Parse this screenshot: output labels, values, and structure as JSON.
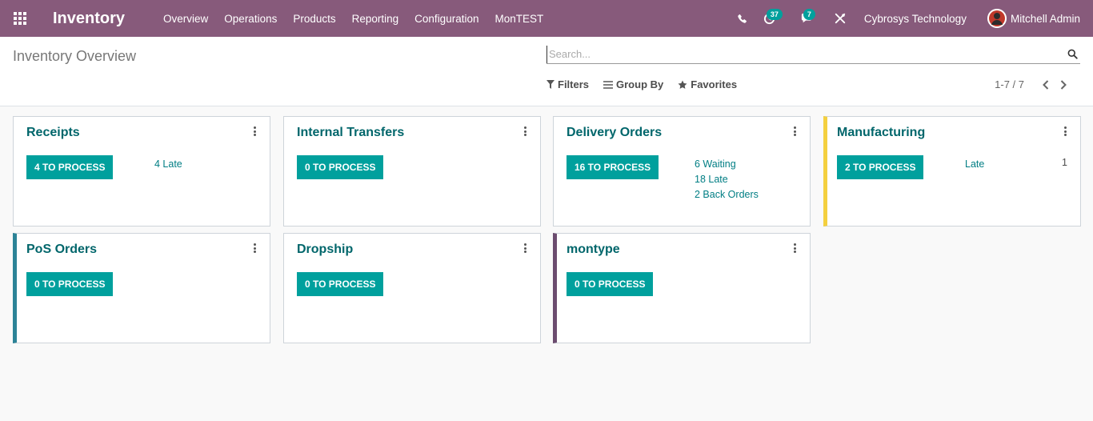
{
  "navbar": {
    "brand": "Inventory",
    "menu": [
      "Overview",
      "Operations",
      "Products",
      "Reporting",
      "Configuration",
      "MonTEST"
    ],
    "activity_badge": "37",
    "messages_badge": "7",
    "company": "Cybrosys Technology",
    "user": "Mitchell Admin",
    "bg_color": "#875a7b"
  },
  "control": {
    "title": "Inventory Overview",
    "search_placeholder": "Search...",
    "filters": "Filters",
    "group_by": "Group By",
    "favorites": "Favorites",
    "pager": "1-7 / 7"
  },
  "cards": [
    {
      "title": "Receipts",
      "button": "4 TO PROCESS",
      "stats": [
        "4 Late"
      ],
      "count": "",
      "bar_color": ""
    },
    {
      "title": "Internal Transfers",
      "button": "0 TO PROCESS",
      "stats": [],
      "count": "",
      "bar_color": ""
    },
    {
      "title": "Delivery Orders",
      "button": "16 TO PROCESS",
      "stats": [
        "6 Waiting",
        "18 Late",
        "2 Back Orders"
      ],
      "count": "",
      "bar_color": ""
    },
    {
      "title": "Manufacturing",
      "button": "2 TO PROCESS",
      "stats": [
        "Late"
      ],
      "count": "1",
      "bar_color": "#f4d03f"
    },
    {
      "title": "PoS Orders",
      "button": "0 TO PROCESS",
      "stats": [],
      "count": "",
      "bar_color": "#2c8397"
    },
    {
      "title": "Dropship",
      "button": "0 TO PROCESS",
      "stats": [],
      "count": "",
      "bar_color": ""
    },
    {
      "title": "montype",
      "button": "0 TO PROCESS",
      "stats": [],
      "count": "",
      "bar_color": "#6c4c6f"
    }
  ],
  "accent_color": "#00a09d"
}
